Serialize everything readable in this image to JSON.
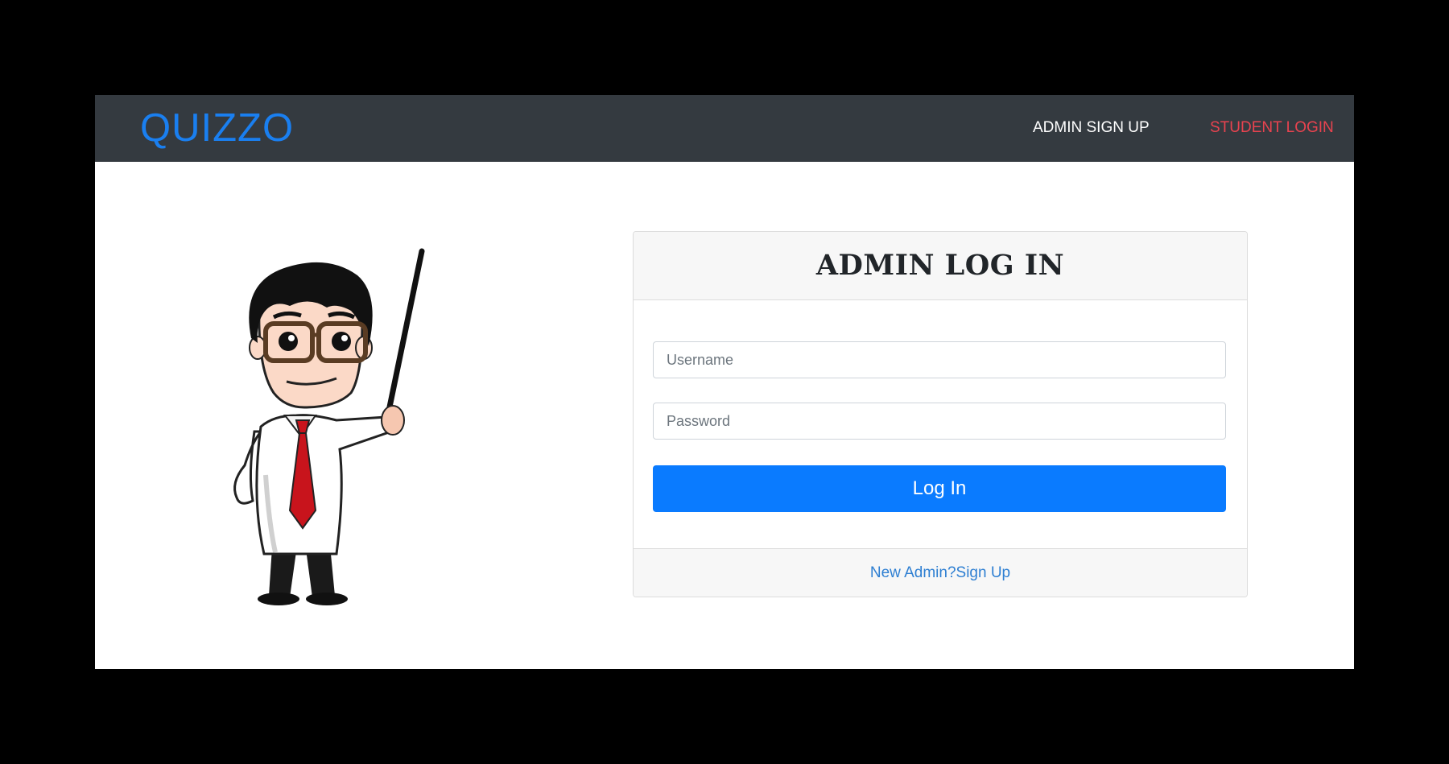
{
  "navbar": {
    "brand": "QUIZZO",
    "links": {
      "admin_signup": "ADMIN SIGN UP",
      "student_login": "STUDENT LOGIN"
    }
  },
  "login_card": {
    "title": "ADMIN LOG IN",
    "username_placeholder": "Username",
    "password_placeholder": "Password",
    "submit_label": "Log In",
    "footer_link": "New Admin?Sign Up"
  },
  "illustration": {
    "icon": "teacher-mascot-icon"
  },
  "colors": {
    "page_background": "#000000",
    "navbar_background": "#343a40",
    "brand": "#1a7ff0",
    "primary_button": "#0a7bff",
    "student_link": "#e8434f",
    "footer_link": "#2e7fd2",
    "card_header_background": "#f7f7f7"
  }
}
